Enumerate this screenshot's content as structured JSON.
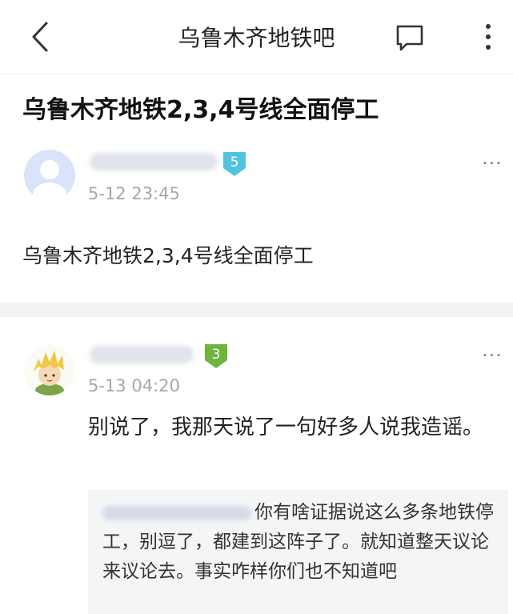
{
  "header": {
    "title": "乌鲁木齐地铁吧",
    "back_icon": "chevron-left-icon",
    "chat_icon": "chat-bubble-icon",
    "more_icon": "more-vertical-icon"
  },
  "post": {
    "title": "乌鲁木齐地铁2,3,4号线全面停工",
    "author": {
      "level": "5",
      "level_color": "#4fc3e0",
      "timestamp": "5-12 23:45"
    },
    "content": "乌鲁木齐地铁2,3,4号线全面停工",
    "more": "···"
  },
  "reply": {
    "author": {
      "level": "3",
      "level_color": "#6fb43c",
      "timestamp": "5-13 04:20"
    },
    "content": "别说了，我那天说了一句好多人说我造谣。",
    "more": "···",
    "quote": {
      "text": "你有啥证据说这么多条地铁停工，别逗了，都建到这阵子了。就知道整天议论来议论去。事实咋样你们也不知道吧"
    }
  }
}
